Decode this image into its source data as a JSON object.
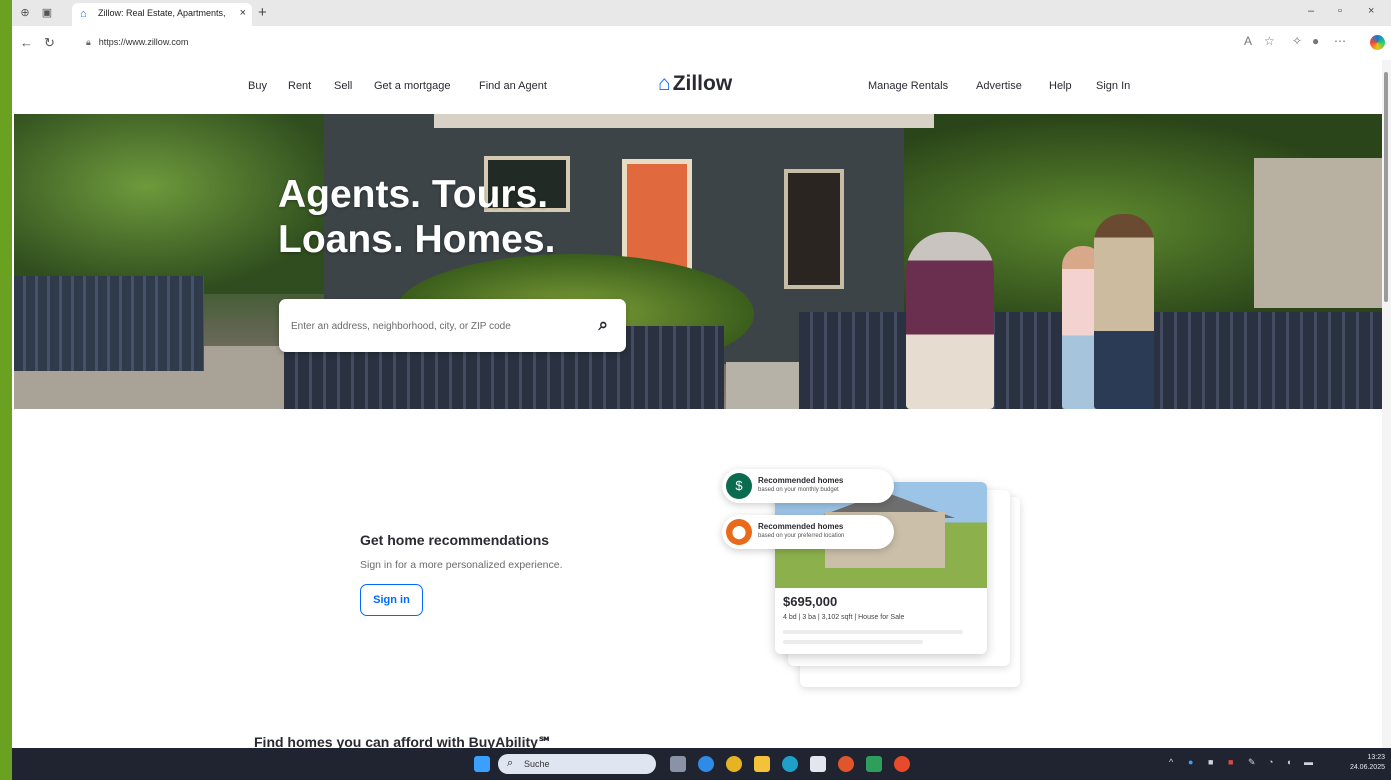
{
  "browser": {
    "tab_title": "Zillow: Real Estate, Apartments, M",
    "tab_close": "×",
    "new_tab": "+",
    "url": "https://www.zillow.com",
    "window_controls": {
      "minimize": "–",
      "maximize": "▫",
      "close": "×"
    }
  },
  "nav": {
    "left": [
      "Buy",
      "Rent",
      "Sell",
      "Get a mortgage",
      "Find an Agent"
    ],
    "logo": "Zillow",
    "right": [
      "Manage Rentals",
      "Advertise",
      "Help",
      "Sign In"
    ]
  },
  "hero": {
    "headline_1": "Agents. Tours.",
    "headline_2": "Loans. Homes.",
    "search_placeholder": "Enter an address, neighborhood, city, or ZIP code"
  },
  "recommendations": {
    "title": "Get home recommendations",
    "subtitle": "Sign in for a more personalized experience.",
    "button": "Sign in"
  },
  "cards": {
    "pill1_title": "Recommended homes",
    "pill1_sub": "based on your monthly budget",
    "pill2_title": "Recommended homes",
    "pill2_sub": "based on your preferred location",
    "price": "$695,000",
    "details": "4 bd | 3 ba | 3,102 sqft | House for Sale"
  },
  "cutoff_heading": "Find homes you can afford with BuyAbility℠",
  "taskbar": {
    "search_label": "Suche",
    "time": "13:23",
    "date": "24.06.2025"
  },
  "colors": {
    "accent": "#006aff",
    "desktop_border": "#6aa121",
    "text": "#2a2a33",
    "taskbar": "#1f2430"
  },
  "icons": [
    "search-icon",
    "zillow-logo-icon",
    "back-icon",
    "refresh-icon",
    "lock-icon",
    "star-icon",
    "windows-start-icon"
  ]
}
